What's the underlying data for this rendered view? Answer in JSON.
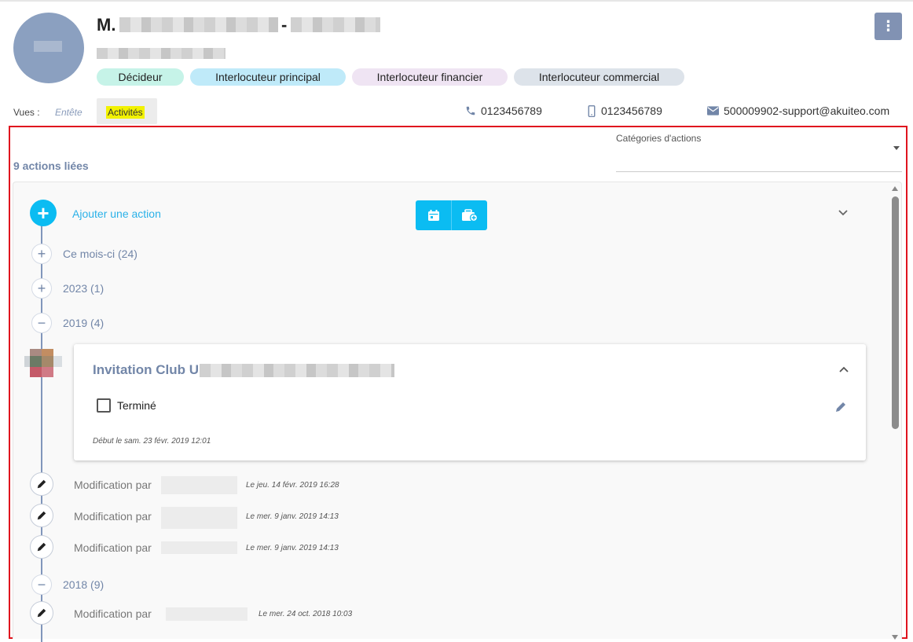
{
  "header": {
    "name_prefix": "M.",
    "name_separator": "-",
    "menu_icon": "⋮",
    "tags": [
      {
        "label": "Décideur",
        "color": "#c6f3e8"
      },
      {
        "label": "Interlocuteur principal",
        "color": "#bfeaf9"
      },
      {
        "label": "Interlocuteur financier",
        "color": "#efe4f3"
      },
      {
        "label": "Interlocuteur commercial",
        "color": "#dde3ea"
      }
    ]
  },
  "views": {
    "label": "Vues :",
    "entete": "Entête",
    "activites": "Activités"
  },
  "contacts": {
    "phone": "0123456789",
    "mobile": "0123456789",
    "email": "500009902-support@akuiteo.com"
  },
  "filters": {
    "category_label": "Catégories d'actions"
  },
  "timeline": {
    "count_label": "9 actions liées",
    "add_label": "Ajouter une action",
    "groups": [
      {
        "label": "Ce mois-ci (24)",
        "expanded": false
      },
      {
        "label": "2023 (1)",
        "expanded": false
      },
      {
        "label": "2019 (4)",
        "expanded": true
      },
      {
        "label": "2018 (9)",
        "expanded": true
      }
    ],
    "card": {
      "title": "Invitation Club U",
      "checkbox_label": "Terminé",
      "start": "Début le sam. 23 févr. 2019 12:01"
    },
    "modifications": [
      {
        "label": "Modification par",
        "date": "Le jeu. 14 févr. 2019 16:28"
      },
      {
        "label": "Modification par",
        "date": "Le mer. 9 janv. 2019 14:13"
      },
      {
        "label": "Modification par",
        "date": "Le mer. 9 janv. 2019 14:13"
      },
      {
        "label": "Modification par",
        "date": "Le mer. 24 oct. 2018 10:03"
      }
    ]
  },
  "colors": {
    "accent": "#0bbcf2",
    "label_blue": "#7286a8",
    "frame_red": "#e0141e"
  }
}
